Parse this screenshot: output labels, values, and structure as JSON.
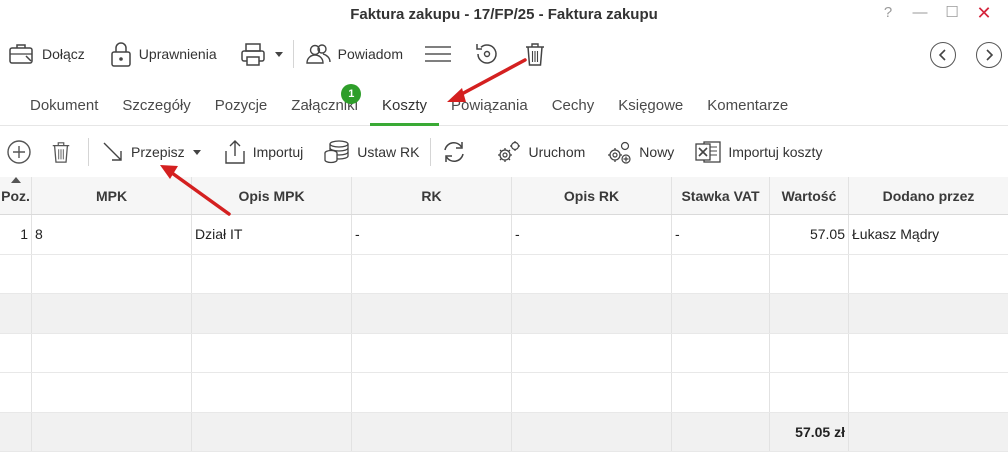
{
  "window": {
    "title": "Faktura zakupu - 17/FP/25 - Faktura zakupu",
    "help": "?",
    "minimize": "—",
    "maximize": "☐",
    "close": "✕"
  },
  "toolbar": {
    "attach": "Dołącz",
    "permissions": "Uprawnienia",
    "notify": "Powiadom"
  },
  "tabs": [
    {
      "label": "Dokument"
    },
    {
      "label": "Szczegóły"
    },
    {
      "label": "Pozycje"
    },
    {
      "label": "Załączniki",
      "badge": "1"
    },
    {
      "label": "Koszty"
    },
    {
      "label": "Powiązania"
    },
    {
      "label": "Cechy"
    },
    {
      "label": "Księgowe"
    },
    {
      "label": "Komentarze"
    }
  ],
  "active_tab": "Koszty",
  "costs_toolbar": {
    "rewrite": "Przepisz",
    "import": "Importuj",
    "set_rk": "Ustaw RK",
    "run": "Uruchom",
    "new": "Nowy",
    "import_costs": "Importuj koszty"
  },
  "table": {
    "columns": [
      "Poz.",
      "MPK",
      "Opis MPK",
      "RK",
      "Opis RK",
      "Stawka VAT",
      "Wartość",
      "Dodano przez"
    ],
    "rows": [
      [
        "1",
        "8",
        "Dział IT",
        "-",
        "-",
        "-",
        "57.05",
        "Łukasz Mądry"
      ]
    ],
    "total": "57.05 zł"
  },
  "colors": {
    "accent": "#3aaa35",
    "badge": "#2e9e2a",
    "close": "#d4243b",
    "arrow": "#d42020"
  }
}
